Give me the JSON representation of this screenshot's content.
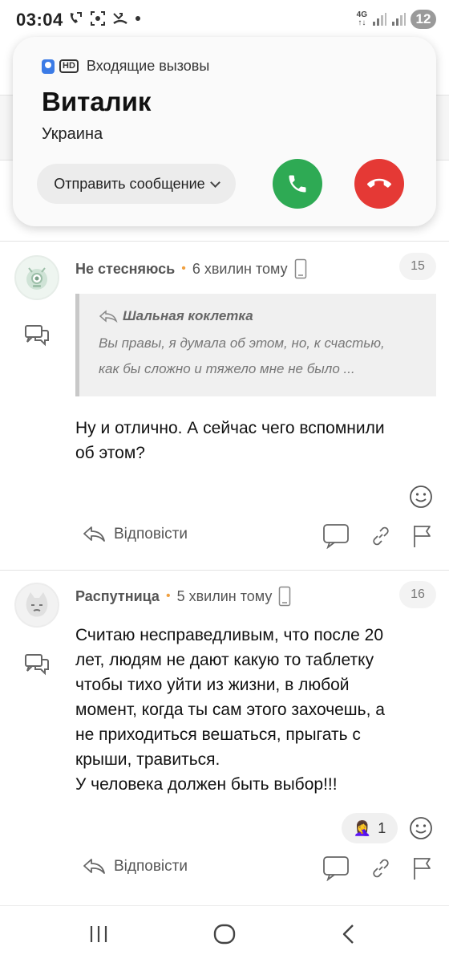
{
  "status_bar": {
    "time": "03:04",
    "network": "4G",
    "battery": "12",
    "icons_left": [
      "call-forward-icon",
      "screenshot-icon",
      "missed-call-icon",
      "dot-icon"
    ],
    "icons_right": [
      "signal-icon",
      "signal-icon",
      "battery-icon"
    ]
  },
  "call": {
    "app_label": "Входящие вызовы",
    "hd_label": "HD",
    "caller_name": "Виталик",
    "caller_location": "Украина",
    "send_message_label": "Отправить сообщение",
    "accept_color": "#2eaa54",
    "decline_color": "#e53935"
  },
  "comments": [
    {
      "author": "Не стесняюсь",
      "time_ago": "6 хвилин тому",
      "score": "15",
      "quote": {
        "author": "Шальная коклетка",
        "line1": "Вы правы, я думала об этом, но, к счастью,",
        "line2": "как бы сложно и тяжело мне не было ..."
      },
      "text_lines": [
        "Ну и отлично. А сейчас чего вспомнили",
        "об этом?"
      ],
      "reply_label": "Відповісти"
    },
    {
      "author": "Распутница",
      "time_ago": "5 хвилин тому",
      "score": "16",
      "text_lines": [
        "Считаю несправедливым, что после 20",
        "лет, людям не дают какую то таблетку",
        "чтобы тихо уйти из жизни, в любой",
        "момент, когда ты сам этого захочешь, а",
        "не приходиться вешаться, прыгать с",
        "крыши, травиться.",
        "У человека должен быть выбор!!!"
      ],
      "reaction": {
        "emoji": "🤦‍♀️",
        "count": "1"
      },
      "reply_label": "Відповісти"
    }
  ],
  "nav": {
    "icons": [
      "recent-apps-icon",
      "home-icon",
      "back-icon"
    ]
  }
}
